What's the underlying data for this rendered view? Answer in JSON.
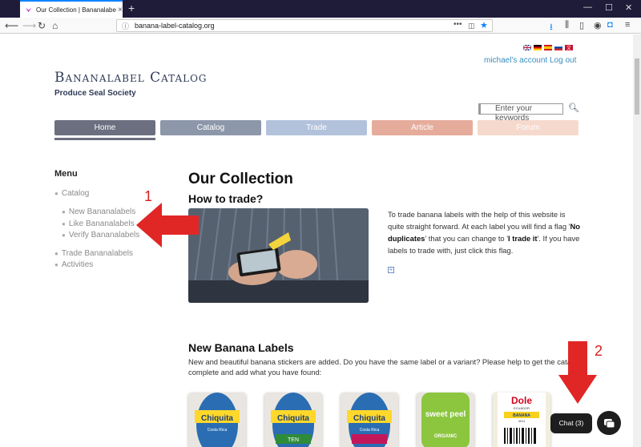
{
  "browser": {
    "tab_title": "Our Collection | Bananalabel Ca…",
    "tab_close": "×",
    "new_tab": "+",
    "url": "banana-label-catalog.org"
  },
  "header": {
    "account": "michael's account",
    "logout": "Log out",
    "brand": "Bananalabel Catalog",
    "subtitle": "Produce Seal Society",
    "search_placeholder": "Enter your keywords"
  },
  "nav": {
    "home": "Home",
    "catalog": "Catalog",
    "trade": "Trade",
    "article": "Article",
    "forum": "Forum"
  },
  "sidebar": {
    "title": "Menu",
    "items": [
      {
        "label": "Catalog"
      },
      {
        "label": "New Bananalabels"
      },
      {
        "label": "Like Bananalabels"
      },
      {
        "label": "Verify Bananalabels"
      },
      {
        "label": "Trade Bananalabels"
      },
      {
        "label": "Activities"
      }
    ]
  },
  "main": {
    "title": "Our Collection",
    "trade_heading": "How to trade?",
    "trade_text_1": "To trade banana labels with the help of this website is quite straight forward. At each label you will find a flag '",
    "trade_bold_1": "No duplicates",
    "trade_text_2": "' that you can change to '",
    "trade_bold_2": "I trade it",
    "trade_text_3": "'. If you have labels to trade with, just click this flag.",
    "expand": "+",
    "new_heading": "New Banana Labels",
    "new_text_1": "New and beautiful banana stickers are added. Do you have the same label or a variant? Please help to get the catalog",
    "new_text_2": "complete and add what you have found:"
  },
  "labels": [
    {
      "brand": "Chiquita",
      "sub": "Costa Rica"
    },
    {
      "brand": "Chiquita",
      "sub": "TEN"
    },
    {
      "brand": "Chiquita",
      "sub": "Costa Rica"
    },
    {
      "brand": "sweet peel",
      "sub": "ORGANIC"
    },
    {
      "brand": "Dole",
      "sub": "ECUADOR",
      "extra": "BANANA",
      "code": "4011"
    }
  ],
  "chat": {
    "label": "Chat (3)"
  },
  "annotations": {
    "one": "1",
    "two": "2"
  },
  "colors": {
    "home": "#6c6f80",
    "catalog": "#8d97aa",
    "trade": "#b3c2db",
    "article": "#e6ac9b",
    "forum": "#f6d9cd",
    "link": "#3a8ec1",
    "annotation": "#d42020"
  }
}
